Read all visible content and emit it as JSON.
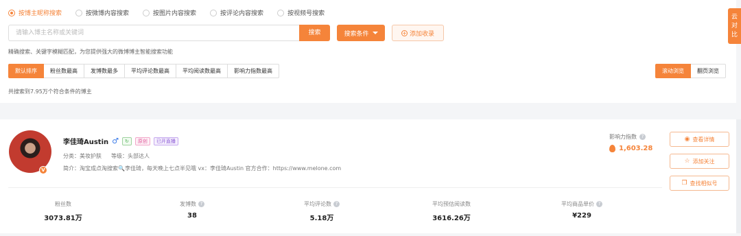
{
  "search_types": [
    {
      "label": "按博主昵称搜索",
      "active": true
    },
    {
      "label": "按微博内容搜索",
      "active": false
    },
    {
      "label": "按图片内容搜索",
      "active": false
    },
    {
      "label": "按评论内容搜索",
      "active": false
    },
    {
      "label": "按视频号搜索",
      "active": false
    }
  ],
  "search": {
    "placeholder": "请输入博主名称或关键词",
    "button": "搜索",
    "conditions_button": "搜索条件",
    "favorite_button": "添加收录",
    "hint": "精确搜索、关键字模糊匹配，为您提供强大的微博博主智能搜索功能"
  },
  "sort_tabs": [
    "默认排序",
    "粉丝数最高",
    "发博数最多",
    "平均评论数最高",
    "平均阅读数最高",
    "影响力指数最高"
  ],
  "view_modes": [
    "滚动浏览",
    "翻页浏览"
  ],
  "result_count": "共搜索到7.95万个符合条件的博主",
  "side_tab": [
    "云",
    "对",
    "比"
  ],
  "blogger": {
    "name": "李佳琦Austin",
    "gender_symbol": "♂",
    "tags": [
      "原创",
      "已开直播"
    ],
    "category": "分类：美妆护肤",
    "level": "等级：头部达人",
    "bio_prefix": "简介：淘宝成点淘搜索",
    "bio_suffix": "李佳琦，每天晚上七点半见哦 vx：李佳琦Austin 官方合作：https://www.melone.com",
    "influence_label": "影响力指数",
    "influence_value": "1,603.28",
    "actions": [
      "查看详情",
      "添加关注",
      "查找相似号"
    ],
    "stats": [
      {
        "label": "粉丝数",
        "value": "3073.81万",
        "help": false
      },
      {
        "label": "发博数",
        "value": "38",
        "help": true
      },
      {
        "label": "平均评论数",
        "value": "5.18万",
        "help": true
      },
      {
        "label": "平均预估阅读数",
        "value": "3616.26万",
        "help": false
      },
      {
        "label": "平均商品单价",
        "value": "¥229",
        "help": true
      }
    ]
  },
  "colors": {
    "accent": "#f5843a",
    "link_blue": "#3b7be8"
  }
}
